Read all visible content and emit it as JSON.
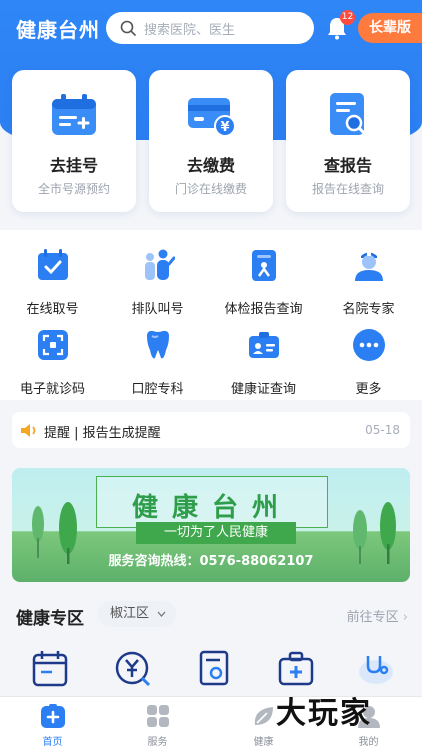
{
  "header": {
    "title": "健康台州",
    "search_placeholder": "搜索医院、医生",
    "notification_count": "12",
    "elder_mode": "长辈版"
  },
  "main_cards": [
    {
      "title": "去挂号",
      "subtitle": "全市号源预约",
      "icon": "calendar-add-icon"
    },
    {
      "title": "去缴费",
      "subtitle": "门诊在线缴费",
      "icon": "card-yuan-icon"
    },
    {
      "title": "查报告",
      "subtitle": "报告在线查询",
      "icon": "report-search-icon"
    }
  ],
  "services": [
    {
      "label": "在线取号",
      "icon": "calendar-check-icon"
    },
    {
      "label": "排队叫号",
      "icon": "queue-people-icon"
    },
    {
      "label": "体检报告查询",
      "icon": "checkup-report-icon"
    },
    {
      "label": "名院专家",
      "icon": "doctor-icon"
    },
    {
      "label": "电子就诊码",
      "icon": "qr-scan-icon"
    },
    {
      "label": "口腔专科",
      "icon": "tooth-icon"
    },
    {
      "label": "健康证查询",
      "icon": "id-card-icon"
    },
    {
      "label": "更多",
      "icon": "more-dots-icon"
    }
  ],
  "notice": {
    "text": "提醒 | 报告生成提醒",
    "date": "05-18"
  },
  "banner": {
    "title": "健康台州",
    "slogan": "一切为了人民健康",
    "hotline": "服务咨询热线：0576-88062107"
  },
  "zone": {
    "title": "健康专区",
    "area": "椒江区",
    "more": "前往专区"
  },
  "tabs": [
    {
      "label": "首页",
      "icon": "home-icon",
      "active": true
    },
    {
      "label": "服务",
      "icon": "grid-icon",
      "active": false
    },
    {
      "label": "健康",
      "icon": "leaf-icon",
      "active": false
    },
    {
      "label": "我的",
      "icon": "user-icon",
      "active": false
    }
  ],
  "watermark": "大玩家",
  "colors": {
    "primary": "#2b7ff2",
    "accent": "#ff7a3d",
    "badge": "#ff4b3e",
    "green": "#3fa84d"
  }
}
